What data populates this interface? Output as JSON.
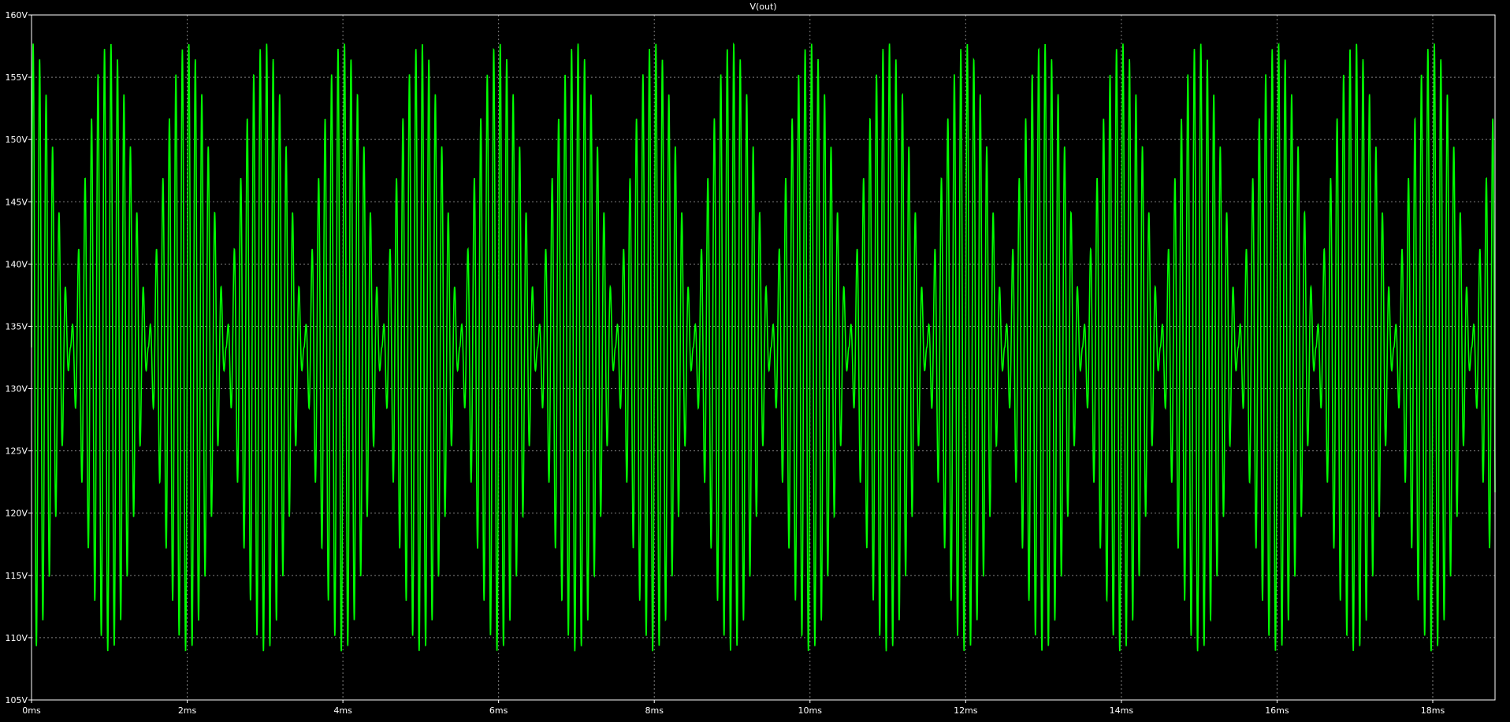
{
  "chart_data": {
    "type": "line",
    "title": "V(out)",
    "xlabel": "",
    "ylabel": "",
    "x_unit": "ms",
    "y_unit": "V",
    "xlim": [
      0,
      18.8
    ],
    "ylim": [
      105,
      160
    ],
    "x_ticks": [
      "0ms",
      "2ms",
      "4ms",
      "6ms",
      "8ms",
      "10ms",
      "12ms",
      "14ms",
      "16ms",
      "18ms"
    ],
    "y_ticks": [
      "160V",
      "155V",
      "150V",
      "145V",
      "140V",
      "135V",
      "130V",
      "125V",
      "120V",
      "115V",
      "110V",
      "105V"
    ],
    "grid": true,
    "series": [
      {
        "name": "V(out)",
        "description_of_signal": "amplitude-modulated oscillation",
        "carrier_frequency_khz": 12,
        "envelope_frequency_khz": 1,
        "center_value": 133.3,
        "max_value": 157.7,
        "min_value": 108.8,
        "x_start": 0,
        "x_end": 18.8
      }
    ],
    "colors": {
      "background": "#000000",
      "trace": "#00ff00",
      "grid": "#808080",
      "frame": "#ffffff",
      "text": "#ffffff"
    }
  }
}
